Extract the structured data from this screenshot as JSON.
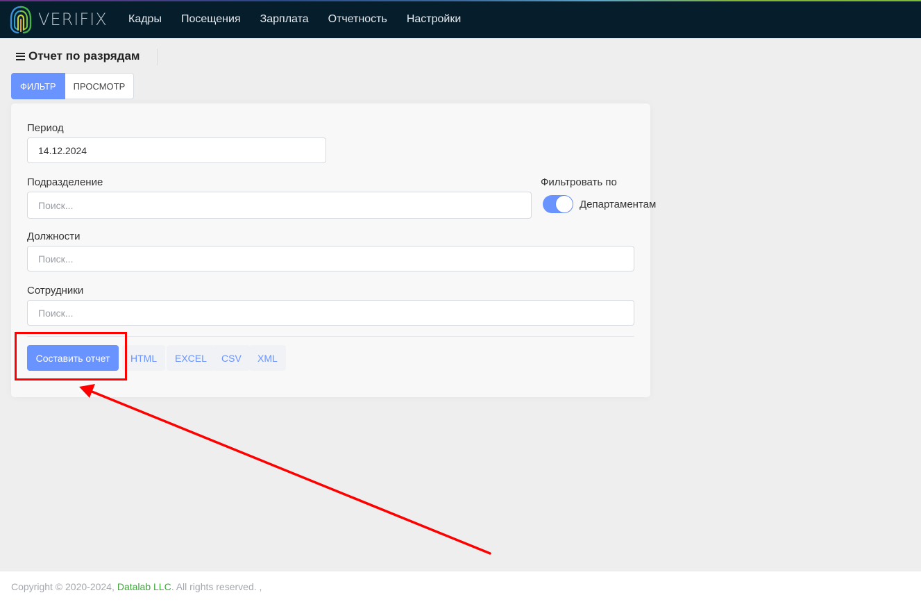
{
  "header": {
    "logo_text": "VERIFIX",
    "nav": [
      "Кадры",
      "Посещения",
      "Зарплата",
      "Отчетность",
      "Настройки"
    ]
  },
  "page": {
    "title": "Отчет по разрядам"
  },
  "tabs": [
    "ФИЛЬТР",
    "ПРОСМОТР"
  ],
  "filter": {
    "period_label": "Период",
    "period_value": "14.12.2024",
    "division_label": "Подразделение",
    "division_placeholder": "Поиск...",
    "filter_by_label": "Фильтровать по",
    "filter_by_toggle_label": "Департаментам",
    "filter_by_toggle_on": true,
    "positions_label": "Должности",
    "positions_placeholder": "Поиск...",
    "employees_label": "Сотрудники",
    "employees_placeholder": "Поиск..."
  },
  "actions": {
    "build_report": "Составить отчет",
    "exports": [
      "HTML",
      "EXCEL",
      "CSV",
      "XML"
    ]
  },
  "footer": {
    "copyright": "Copyright © 2020-2024,",
    "company": "Datalab LLC",
    "rights": ". All rights reserved. ,"
  },
  "colors": {
    "primary": "#6993ff",
    "header_bg": "#061d2c",
    "annotation": "#ff0000",
    "footer_link": "#3aaa35"
  }
}
